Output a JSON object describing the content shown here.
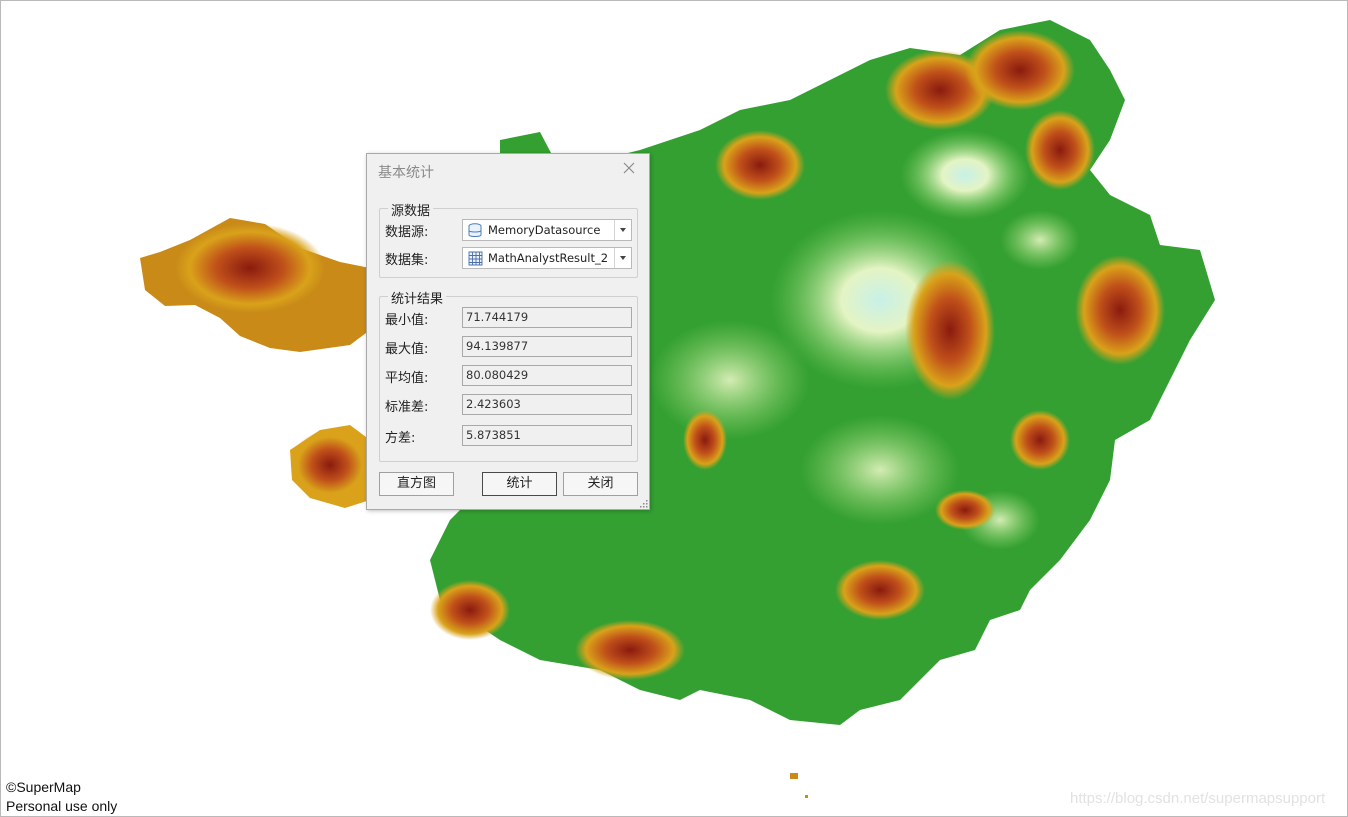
{
  "dialog": {
    "title": "基本统计",
    "source_group": {
      "legend": "源数据",
      "datasource_label": "数据源:",
      "datasource_value": "MemoryDatasource",
      "dataset_label": "数据集:",
      "dataset_value": "MathAnalystResult_2"
    },
    "result_group": {
      "legend": "统计结果",
      "rows": [
        {
          "label": "最小值:",
          "value": "71.744179"
        },
        {
          "label": "最大值:",
          "value": "94.139877"
        },
        {
          "label": "平均值:",
          "value": "80.080429"
        },
        {
          "label": "标准差:",
          "value": "2.423603"
        },
        {
          "label": "方差:",
          "value": "5.873851"
        }
      ]
    },
    "buttons": {
      "histogram": "直方图",
      "statistics": "统计",
      "close": "关闭"
    }
  },
  "map": {
    "copyright_line1": "©SuperMap",
    "copyright_line2": "Personal use only",
    "watermark": "https://blog.csdn.net/supermapsupport"
  },
  "colors": {
    "lowland": "#2f9a2f",
    "plain": "#cfeec0",
    "hill": "#d9a21a",
    "mountain": "#8a1a0e"
  }
}
